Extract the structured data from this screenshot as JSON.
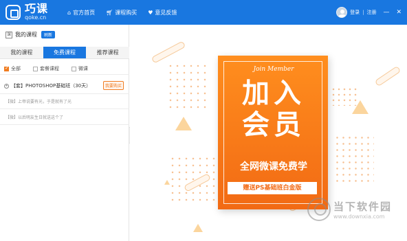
{
  "app": {
    "logo_cn": "巧课",
    "logo_en": "qoke.cn"
  },
  "nav": [
    {
      "icon": "home-icon",
      "label": "官方首页"
    },
    {
      "icon": "cart-icon",
      "label": "课程购买"
    },
    {
      "icon": "feedback-icon",
      "label": "意见反馈"
    }
  ],
  "user": {
    "login": "登录",
    "separator": "|",
    "register": "注册"
  },
  "window": {
    "minimize": "—",
    "close": "✕"
  },
  "sidebar": {
    "title_icon_text": "课",
    "title": "我的课程",
    "refresh": "刷新",
    "tabs": [
      "我的课程",
      "免费课程",
      "推荐课程"
    ],
    "active_tab": 1,
    "filters": [
      {
        "label": "全部",
        "checked": true
      },
      {
        "label": "套餐课程",
        "checked": false
      },
      {
        "label": "微课",
        "checked": false
      }
    ],
    "course": {
      "expand_symbol": "+",
      "title": "【套】PHOTOSHOP基础班（30天）",
      "buy_label": "我要购买"
    },
    "sub_items": [
      "【微】上帝说要有光，于是就有了光",
      "【微】以后明友生日就送这个了"
    ],
    "collapse_symbol": "‹"
  },
  "poster": {
    "join": "Join Member",
    "big_line1": "加入",
    "big_line2": "会员",
    "slogan": "全网微课免费学",
    "gift": "赠送PS基础班白金版",
    "colors": {
      "top": "#ff8e1e",
      "bottom": "#f26a14"
    }
  },
  "watermark": {
    "cn": "当下软件园",
    "en": "www.downxia.com"
  },
  "colors": {
    "brand_blue": "#1977e0",
    "accent_orange": "#f07c20"
  }
}
